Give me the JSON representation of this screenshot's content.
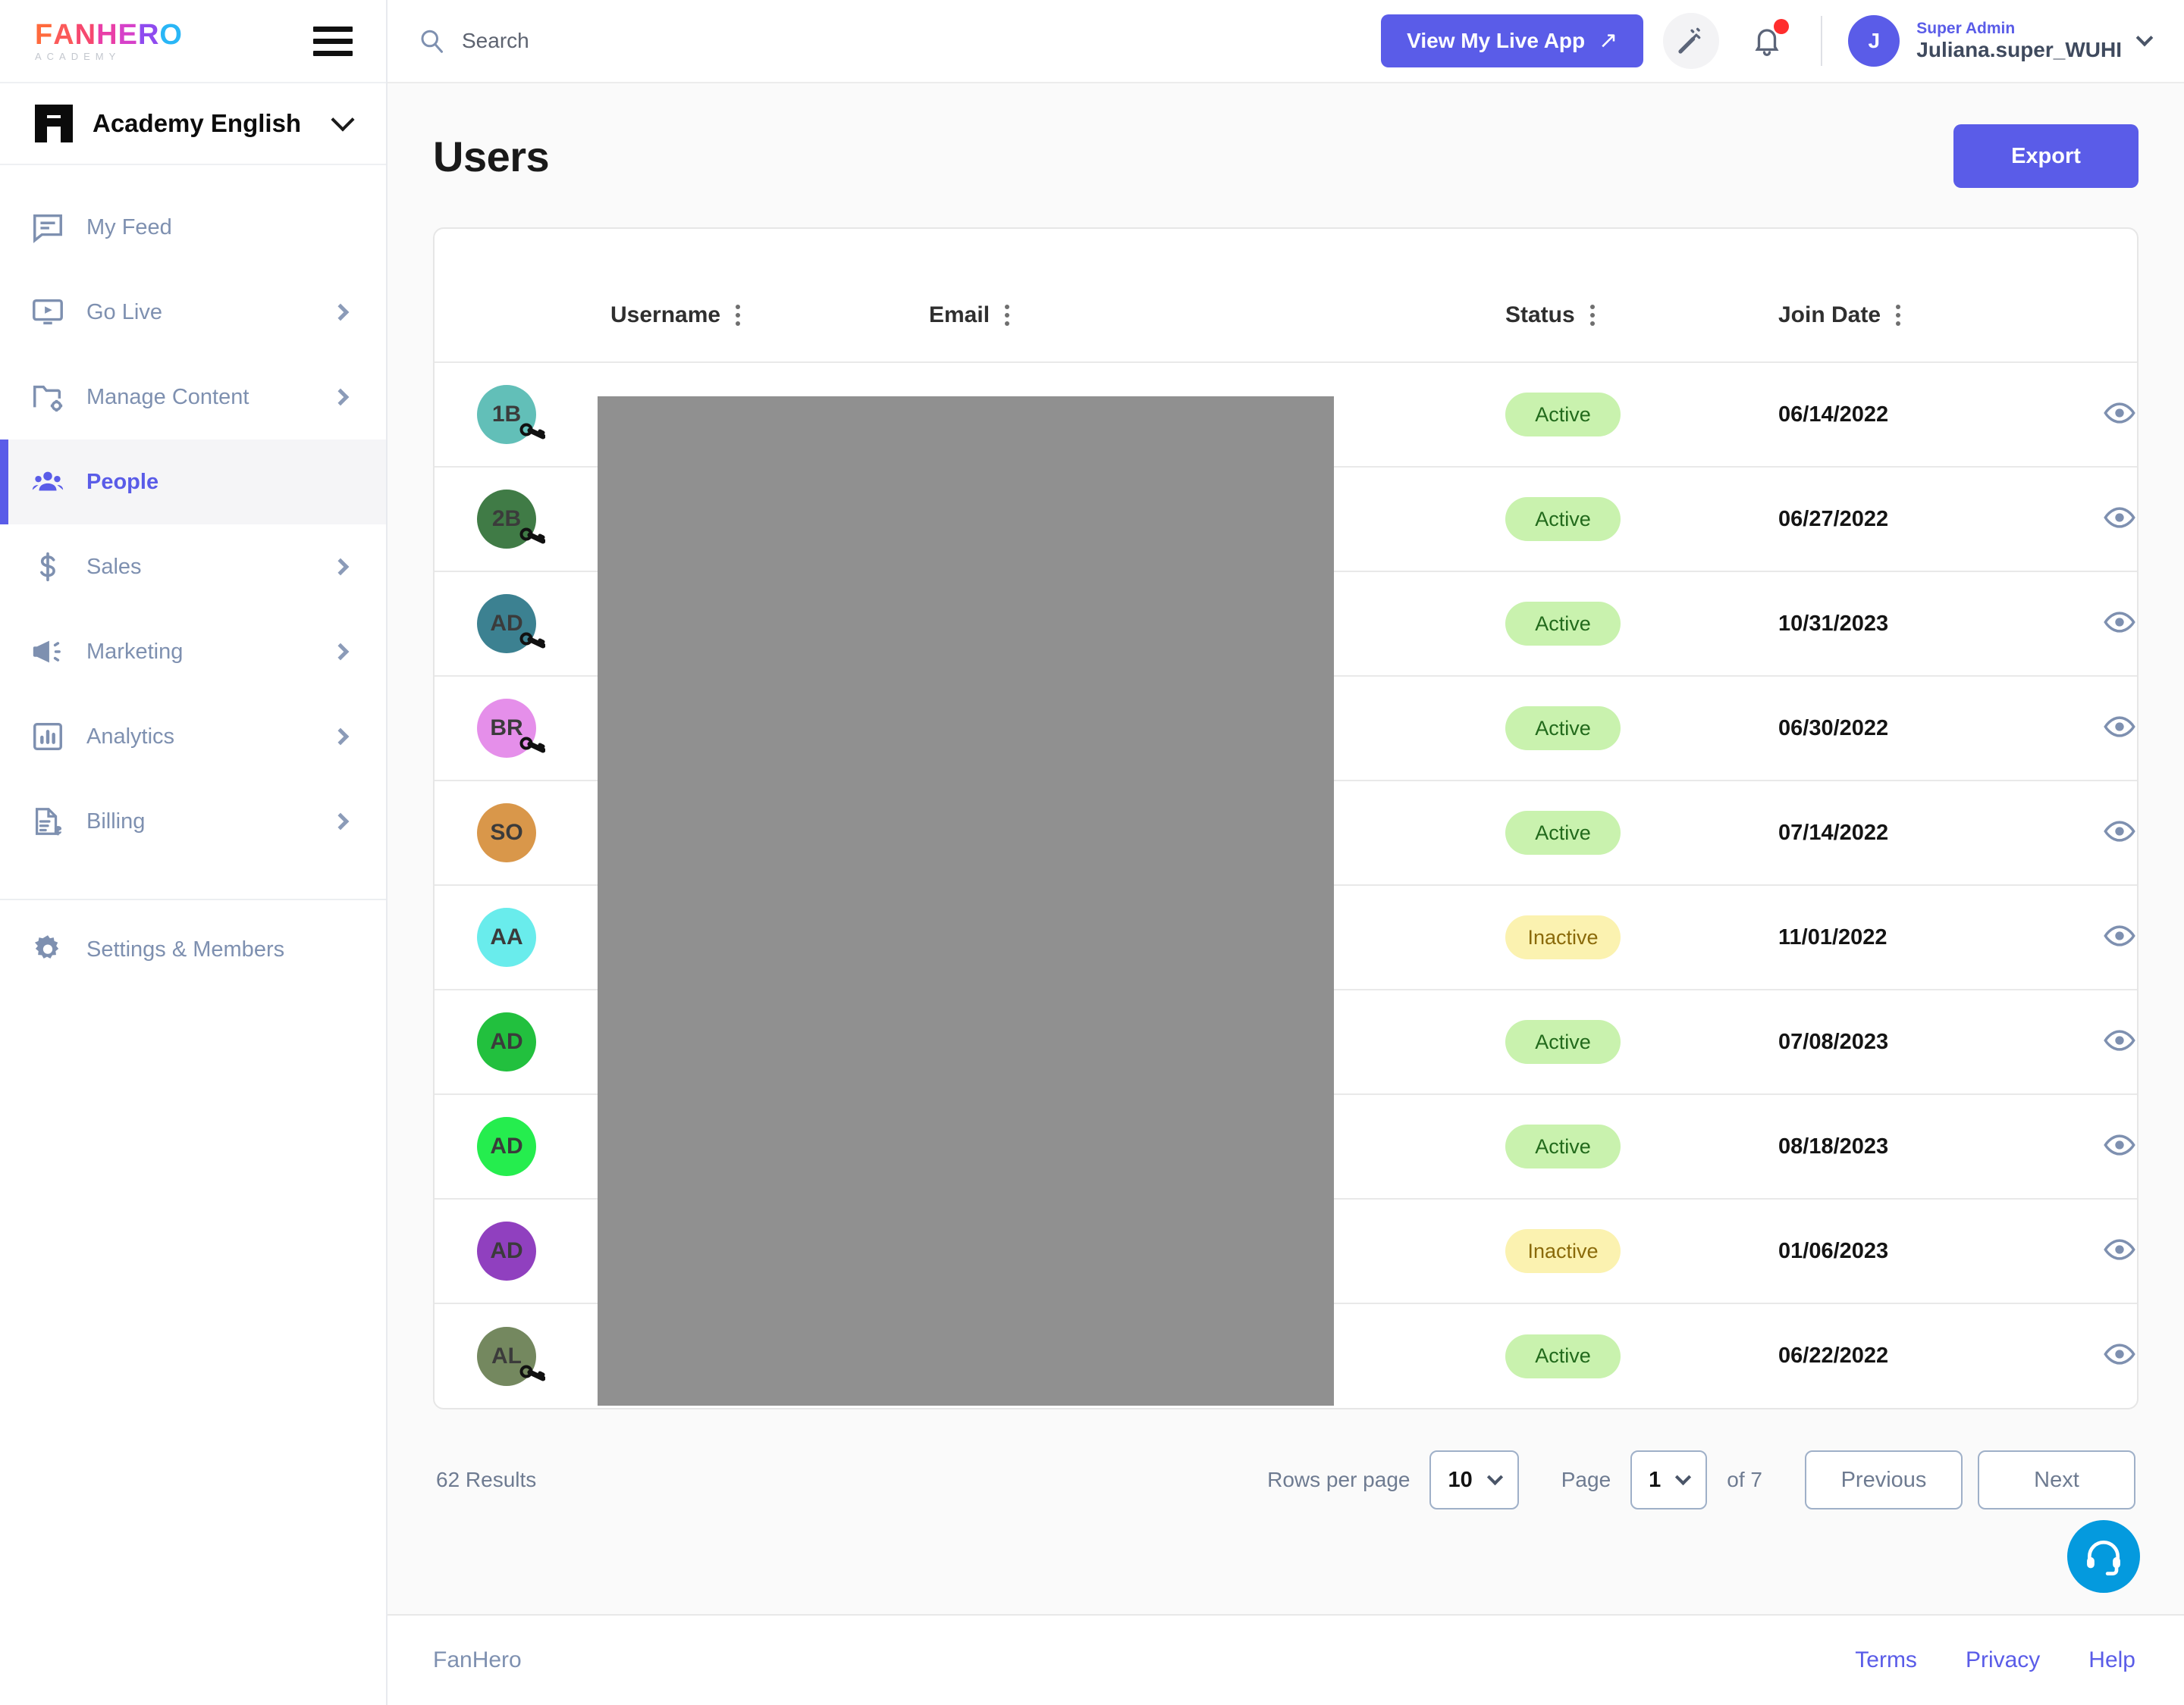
{
  "brand": {
    "logo_letters": [
      "F",
      "A",
      "N",
      "H",
      "E",
      "R",
      "O"
    ],
    "logo_sub": "ACADEMY",
    "hamburger": "menu-icon"
  },
  "workspace": {
    "name": "Academy English"
  },
  "sidebar": {
    "items": [
      {
        "label": "My Feed",
        "icon": "feed-icon",
        "chevron": false,
        "active": false
      },
      {
        "label": "Go Live",
        "icon": "video-icon",
        "chevron": true,
        "active": false
      },
      {
        "label": "Manage Content",
        "icon": "folder-gear-icon",
        "chevron": true,
        "active": false
      },
      {
        "label": "People",
        "icon": "people-icon",
        "chevron": false,
        "active": true
      },
      {
        "label": "Sales",
        "icon": "dollar-icon",
        "chevron": true,
        "active": false
      },
      {
        "label": "Marketing",
        "icon": "megaphone-icon",
        "chevron": true,
        "active": false
      },
      {
        "label": "Analytics",
        "icon": "bar-chart-icon",
        "chevron": true,
        "active": false
      },
      {
        "label": "Billing",
        "icon": "invoice-icon",
        "chevron": true,
        "active": false
      }
    ],
    "settings": {
      "label": "Settings & Members",
      "icon": "gear-icon"
    }
  },
  "topbar": {
    "search_placeholder": "Search",
    "live_button": "View My Live App",
    "live_button_arrow": "↗",
    "wand_icon": "magic-wand-icon",
    "bell_icon": "notification-bell-icon",
    "notification_dot": true,
    "user": {
      "initial": "J",
      "role": "Super Admin",
      "name": "Juliana.super_WUHI"
    }
  },
  "page": {
    "title": "Users",
    "export_label": "Export"
  },
  "table": {
    "columns": [
      {
        "key": "avatar",
        "label": "",
        "kebab": false
      },
      {
        "key": "username",
        "label": "Username",
        "kebab": true
      },
      {
        "key": "email",
        "label": "Email",
        "kebab": true
      },
      {
        "key": "status",
        "label": "Status",
        "kebab": true
      },
      {
        "key": "joindate",
        "label": "Join Date",
        "kebab": true
      },
      {
        "key": "action",
        "label": "",
        "kebab": false
      }
    ],
    "rows": [
      {
        "initials": "1B",
        "color": "#62bfb8",
        "key_badge": true,
        "username": "",
        "email": "",
        "status": "Active",
        "join_date": "06/14/2022"
      },
      {
        "initials": "2B",
        "color": "#407b46",
        "key_badge": true,
        "username": "",
        "email": "",
        "status": "Active",
        "join_date": "06/27/2022"
      },
      {
        "initials": "AD",
        "color": "#3c8191",
        "key_badge": true,
        "username": "",
        "email": "",
        "status": "Active",
        "join_date": "10/31/2023"
      },
      {
        "initials": "BR",
        "color": "#e58fea",
        "key_badge": true,
        "username": "",
        "email": "",
        "status": "Active",
        "join_date": "06/30/2022"
      },
      {
        "initials": "SO",
        "color": "#d9974a",
        "key_badge": false,
        "username": "",
        "email": "",
        "status": "Active",
        "join_date": "07/14/2022"
      },
      {
        "initials": "AA",
        "color": "#69ecec",
        "key_badge": false,
        "username": "",
        "email": "",
        "status": "Inactive",
        "join_date": "11/01/2022"
      },
      {
        "initials": "AD",
        "color": "#22c03e",
        "key_badge": false,
        "username": "",
        "email": "",
        "status": "Active",
        "join_date": "07/08/2023"
      },
      {
        "initials": "AD",
        "color": "#25ed4e",
        "key_badge": false,
        "username": "",
        "email": "",
        "status": "Active",
        "join_date": "08/18/2023"
      },
      {
        "initials": "AD",
        "color": "#9040bf",
        "key_badge": false,
        "username": "",
        "email": "",
        "status": "Inactive",
        "join_date": "01/06/2023"
      },
      {
        "initials": "AL",
        "color": "#74885f",
        "key_badge": true,
        "username": "",
        "email": "",
        "status": "Active",
        "join_date": "06/22/2022"
      }
    ]
  },
  "pagination": {
    "results_text": "62 Results",
    "rows_per_page_label": "Rows per page",
    "rows_per_page_value": "10",
    "page_label": "Page",
    "page_value": "1",
    "of_text": "of 7",
    "previous_label": "Previous",
    "next_label": "Next"
  },
  "support": {
    "icon": "headset-support-icon"
  },
  "footer": {
    "brand": "FanHero",
    "links": [
      "Terms",
      "Privacy",
      "Help"
    ]
  },
  "colors": {
    "accent": "#5a5ce8",
    "muted": "#7e90b0",
    "active_badge_bg": "#c9f2ae",
    "active_badge_text": "#226a1c",
    "inactive_badge_bg": "#fbf2b0",
    "inactive_badge_text": "#8a6a0a",
    "support_fab": "#049ade",
    "redaction": "#909090"
  }
}
